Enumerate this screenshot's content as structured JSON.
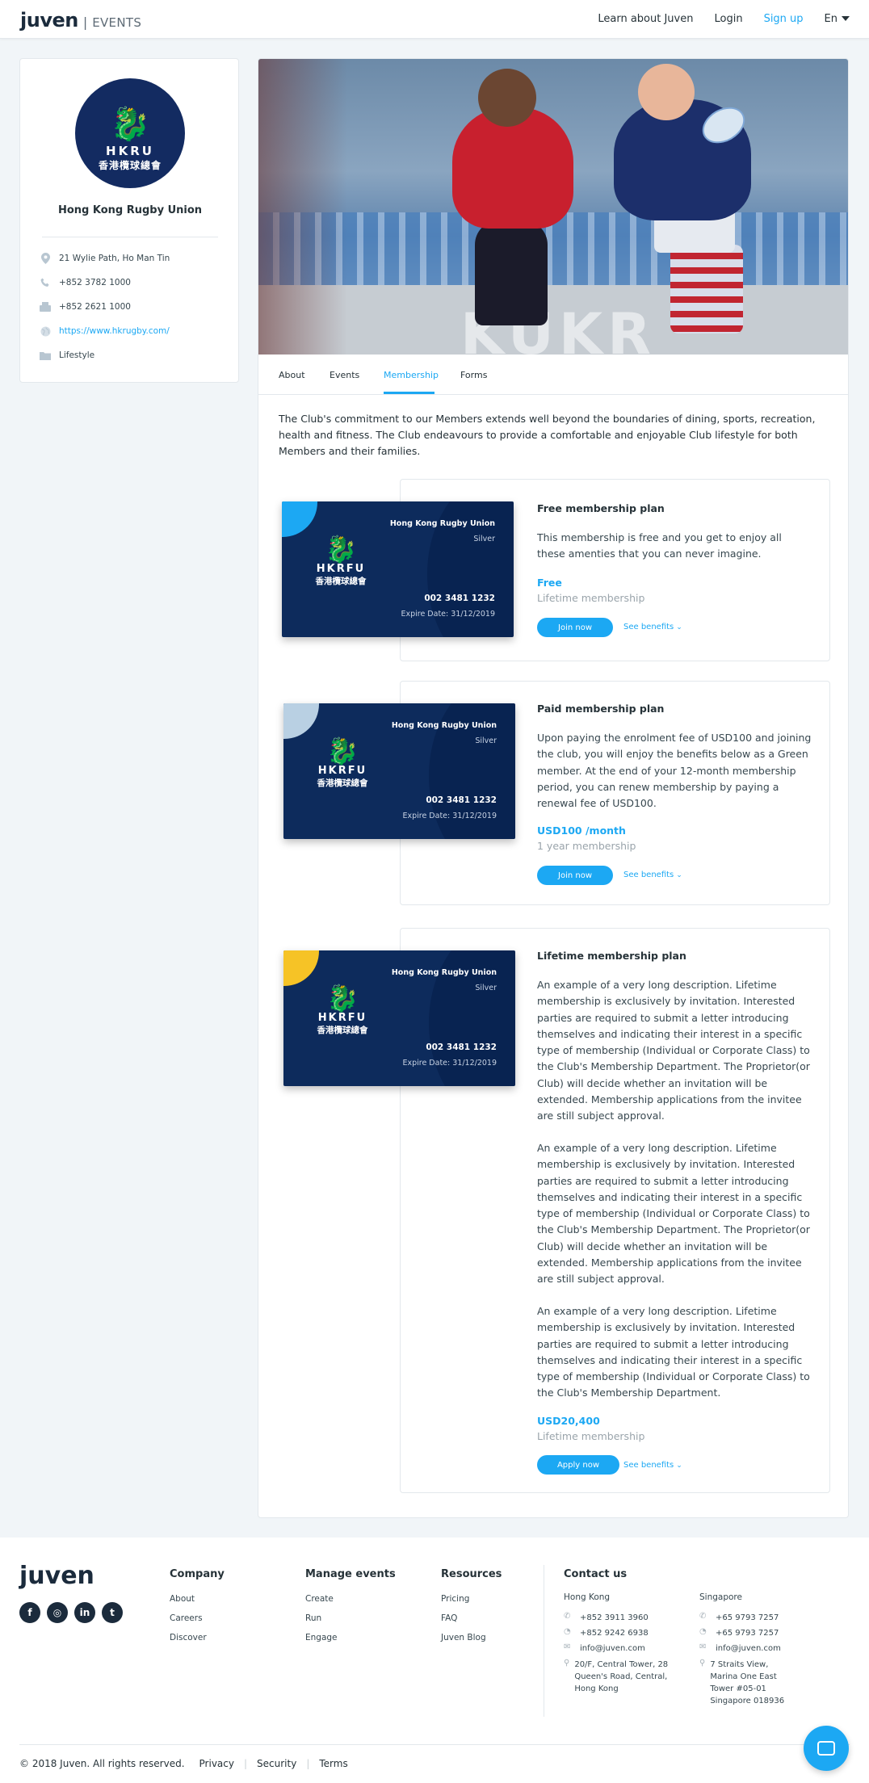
{
  "header": {
    "logo": "juven",
    "section": "EVENTS",
    "nav": {
      "learn": "Learn about Juven",
      "login": "Login",
      "signup": "Sign up",
      "lang": "En"
    }
  },
  "profile": {
    "logo_abbr": "HKRU",
    "logo_cjk": "香港欖球總會",
    "name": "Hong Kong Rugby Union",
    "address": "21 Wylie Path, Ho Man Tin",
    "phone": "+852 3782 1000",
    "fax": "+852 2621 1000",
    "website": "https://www.hkrugby.com/",
    "category": "Lifestyle"
  },
  "tabs": [
    "About",
    "Events",
    "Membership",
    "Forms"
  ],
  "intro": "The Club's commitment to our Members extends well beyond the boundaries of dining, sports, recreation, health and fitness. The Club endeavours to provide a comfortable and enjoyable Club lifestyle for both Members and their families.",
  "hero_sponsor": "KUKR",
  "card": {
    "club": "Hong Kong Rugby Union",
    "tier": "Silver",
    "abbr": "HKRFU",
    "cjk": "香港欖球總會",
    "number": "002 3481 1232",
    "expire": "Expire Date: 31/12/2019"
  },
  "plans": [
    {
      "title": "Free membership plan",
      "description": "This membership is free and you get to enjoy all these amenties that you can never imagine.",
      "price": "Free",
      "period": "Lifetime membership",
      "button": "Join now",
      "benefits": "See  benefits",
      "corner_color": "#1ca8f3"
    },
    {
      "title": "Paid membership plan",
      "description": "Upon paying the enrolment fee of USD100 and joining the club, you will enjoy the benefits below as a Green member. At the end of your 12-month membership period, you can renew membership by paying a renewal fee of USD100.",
      "price": "USD100 /month",
      "period": "1 year membership",
      "button": "Join now",
      "benefits": "See  benefits",
      "corner_color": "#b9d0e3"
    },
    {
      "title": "Lifetime membership plan",
      "description_p1": "An example of a very long description. Lifetime membership is exclusively by invitation. Interested parties are required to submit a letter introducing themselves and indicating their interest in a specific type of membership (Individual or Corporate Class) to the Club's Membership Department. The Proprietor(or Club) will decide whether an invitation will be extended. Membership applications from the invitee are still subject approval.",
      "description_p2": "An example of a very long description. Lifetime membership is exclusively by invitation. Interested parties are required to submit a letter introducing themselves and indicating their interest in a specific type of membership (Individual or Corporate Class) to the Club's Membership Department. The Proprietor(or Club) will decide whether an invitation will be extended. Membership applications from the invitee are still subject approval.",
      "description_p3": "An example of a very long description. Lifetime membership is exclusively by invitation. Interested parties are required to submit a letter introducing themselves and indicating their interest in a specific type of membership (Individual or Corporate Class) to the Club's Membership Department.",
      "price": "USD20,400",
      "period": "Lifetime membership",
      "button": "Apply now",
      "benefits": "See  benefits",
      "corner_color": "#f6c326"
    }
  ],
  "footer": {
    "logo": "juven",
    "socials": [
      "facebook-icon",
      "instagram-icon",
      "linkedin-icon",
      "twitter-icon"
    ],
    "company": {
      "title": "Company",
      "links": [
        "About",
        "Careers",
        "Discover"
      ]
    },
    "manage": {
      "title": "Manage events",
      "links": [
        "Create",
        "Run",
        "Engage"
      ]
    },
    "resources": {
      "title": "Resources",
      "links": [
        "Pricing",
        "FAQ",
        "Juven Blog"
      ]
    },
    "contact": {
      "title": "Contact us",
      "hk": {
        "region": "Hong Kong",
        "phone": "+852 3911 3960",
        "whatsapp": "+852 9242 6938",
        "email": "info@juven.com",
        "address": "20/F, Central Tower, 28 Queen's Road, Central, Hong Kong"
      },
      "sg": {
        "region": "Singapore",
        "phone": "+65 9793 7257",
        "whatsapp": "+65 9793 7257",
        "email": "info@juven.com",
        "address": "7 Straits View, Marina One East Tower #05-01 Singapore 018936"
      }
    },
    "copyright": "© 2018 Juven. All rights reserved.",
    "bottom_links": [
      "Privacy",
      "Security",
      "Terms"
    ]
  },
  "colors": {
    "accent": "#1ca8f3",
    "card_bg": "#0d2b5c"
  }
}
